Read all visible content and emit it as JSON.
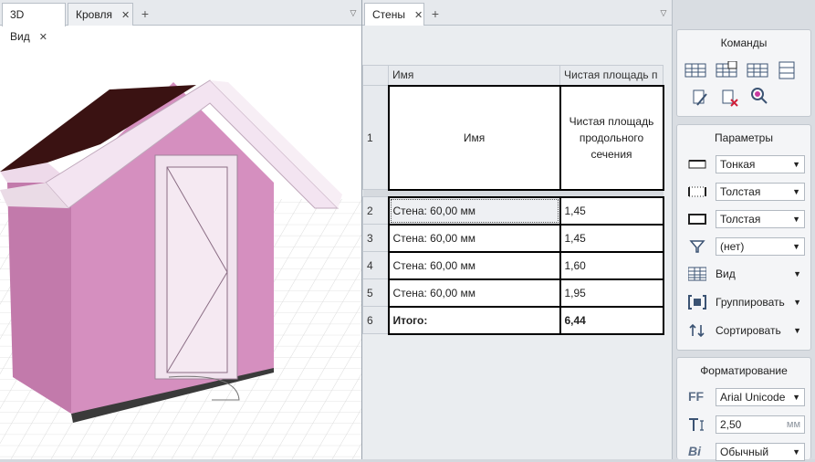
{
  "left_tabs": [
    {
      "label": "3D Вид",
      "close": "✕"
    },
    {
      "label": "Кровля",
      "close": "✕"
    }
  ],
  "mid_tabs": [
    {
      "label": "Стены",
      "close": "✕"
    }
  ],
  "tab_plus": "+",
  "tab_menu": "▽",
  "table": {
    "col_headers": [
      "Имя",
      "Чистая площадь п"
    ],
    "header_row_num": "1",
    "header_cells": [
      "Имя",
      "Чистая площадь продольного сечения"
    ],
    "rows": [
      {
        "num": "2",
        "name": "Стена: 60,00 мм",
        "value": "1,45"
      },
      {
        "num": "3",
        "name": "Стена: 60,00 мм",
        "value": "1,45"
      },
      {
        "num": "4",
        "name": "Стена: 60,00 мм",
        "value": "1,60"
      },
      {
        "num": "5",
        "name": "Стена: 60,00 мм",
        "value": "1,95"
      }
    ],
    "total": {
      "num": "6",
      "name": "Итого:",
      "value": "6,44"
    }
  },
  "panels": {
    "commands": {
      "title": "Команды"
    },
    "params": {
      "title": "Параметры",
      "line_thin": "Тонкая",
      "line_thick1": "Толстая",
      "line_thick2": "Толстая",
      "filter": "(нет)",
      "view": "Вид",
      "group": "Группировать",
      "sort": "Сортировать"
    },
    "format": {
      "title": "Форматирование",
      "font": "Arial Unicode",
      "size": "2,50",
      "size_unit": "мм",
      "style": "Обычный",
      "font_icon": "FF",
      "style_icon": "Bi"
    }
  },
  "colors": {
    "wall": "#d58fbf",
    "roof": "#3a1212",
    "trim": "#f3e4f1"
  }
}
